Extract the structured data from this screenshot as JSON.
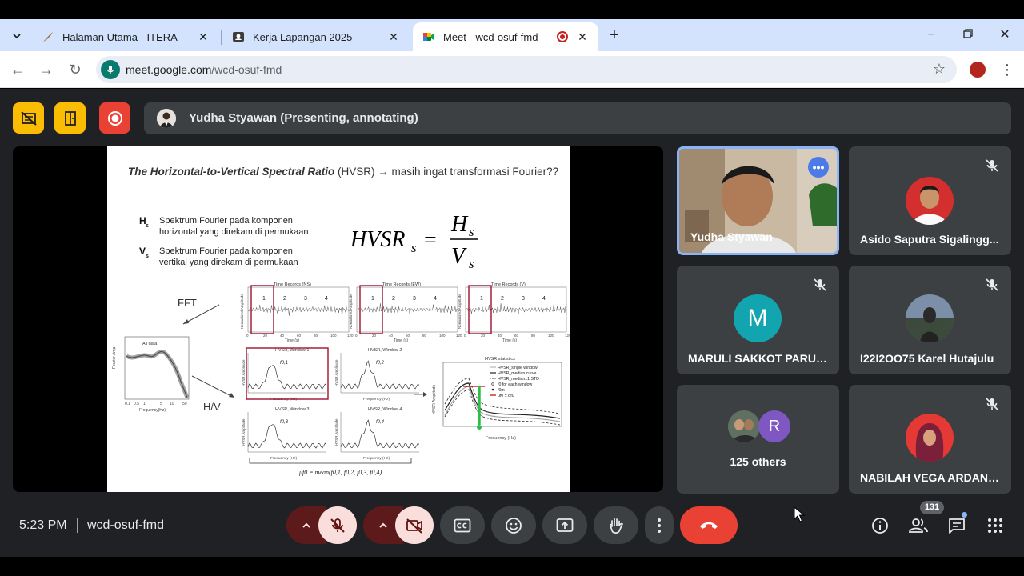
{
  "browser": {
    "tabs": [
      {
        "title": "Halaman Utama - ITERA",
        "icon": "feather-icon"
      },
      {
        "title": "Kerja Lapangan 2025",
        "icon": "portrait-icon"
      },
      {
        "title": "Meet - wcd-osuf-fmd",
        "icon": "meet-icon",
        "active": true
      }
    ],
    "url_host": "meet.google.com",
    "url_path": "/wcd-osuf-fmd"
  },
  "meet": {
    "presenter_banner": "Yudha Styawan (Presenting, annotating)",
    "clock": "5:23 PM",
    "meeting_code": "wcd-osuf-fmd",
    "participant_count": "131",
    "colors": {
      "accent": "#8ab4f8",
      "end_call": "#e94235",
      "record": "#e94235",
      "host_tools": "#fbbc04"
    }
  },
  "slide": {
    "title_italic": "The Horizontal-to-Vertical Spectral Ratio",
    "title_rest": " (HVSR) → masih ingat transformasi Fourier??",
    "hs_symbol": "H",
    "hs_sub": "s",
    "hs_desc_1": "Spektrum Fourier pada komponen",
    "hs_desc_2": "horizontal yang direkam di permukaan",
    "vs_symbol": "V",
    "vs_sub": "s",
    "vs_desc_1": "Spektrum Fourier pada komponen",
    "vs_desc_2": "vertikal yang direkam di permukaan",
    "formula_lhs": "HVSR",
    "formula_lhs_sub": "s",
    "formula_eq": "=",
    "formula_num": "H",
    "formula_num_sub": "s",
    "formula_den": "V",
    "formula_den_sub": "s",
    "fft_label": "FFT",
    "hv_label": "H/V",
    "spectrum_title": "All data",
    "spectrum_xlabel": "Frequency(Hz)",
    "spectrum_ylabel": "Fourier Amp.",
    "spectrum_ticks": [
      "0.1",
      "0.5",
      "1",
      "5",
      "10",
      "50"
    ],
    "time_record_titles": [
      "Time Records (NS)",
      "Time Records (EW)",
      "Time Records (V)"
    ],
    "window_numbers": [
      "1",
      "2",
      "3",
      "4"
    ],
    "time_xlabel": "Time (s)",
    "time_ylabel": "Normalized Amplitude",
    "time_ticks": [
      "0",
      "20",
      "40",
      "60",
      "80",
      "100",
      "120"
    ],
    "hv_windows": [
      {
        "title": "HVSR, Window 1",
        "label": "f0,1"
      },
      {
        "title": "HVSR, Window 2",
        "label": "f0,2"
      },
      {
        "title": "HVSR, Window 3",
        "label": "f0,3"
      },
      {
        "title": "HVSR, Window 4",
        "label": "f0,4"
      }
    ],
    "hv_xlabel": "Frequency (Hz)",
    "hv_ylabel": "HVSR Amplitude",
    "stats_title": "HVSR statistics",
    "stats_legend": [
      "HVSR_single window",
      "HVSR_median curve",
      "HVSR_median±1 STD",
      "f0 for each window",
      "f0m",
      "μf0 ± σf0"
    ],
    "stats_xlabel": "Frequency (Hz)",
    "stats_ylabel": "HVSR Amplitude",
    "mean_formula": "μf0 = mean(f0,1, f0,2, f0,3, f0,4)"
  },
  "participants": [
    {
      "name": "Yudha Styawan",
      "type": "video"
    },
    {
      "name": "Asido Saputra Sigalingg...",
      "type": "photo",
      "muted": true
    },
    {
      "name": "MARULI SAKKOT PARUL...",
      "type": "letter",
      "letter": "M",
      "color": "#12a4af",
      "muted": true
    },
    {
      "name": "I22I2OO75 Karel Hutajulu",
      "type": "photo",
      "muted": true
    },
    {
      "name": "125 others",
      "type": "others",
      "letter": "R",
      "color": "#7e57c2"
    },
    {
      "name": "NABILAH VEGA ARDANI...",
      "type": "photo",
      "muted": true
    }
  ]
}
